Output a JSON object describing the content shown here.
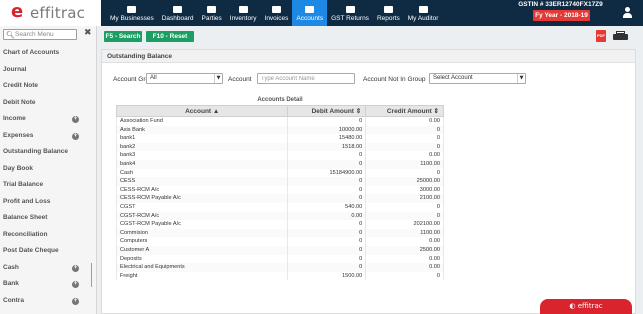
{
  "brand": {
    "name": "effitrac",
    "logo_mark": "e",
    "accent": "#d9232d",
    "topbar_color": "#0f2a43",
    "active_tab_color": "#1e88e5"
  },
  "nav": [
    {
      "label": "My Businesses",
      "icon": "briefcase-icon"
    },
    {
      "label": "Dashboard",
      "icon": "monitor-icon"
    },
    {
      "label": "Parties",
      "icon": "users-icon"
    },
    {
      "label": "Inventory",
      "icon": "box-icon"
    },
    {
      "label": "Invoices",
      "icon": "document-icon"
    },
    {
      "label": "Accounts",
      "icon": "briefcase-icon",
      "active": true
    },
    {
      "label": "GST Returns",
      "icon": "tax-icon"
    },
    {
      "label": "Reports",
      "icon": "folder-icon"
    },
    {
      "label": "My Auditor",
      "icon": "folder-user-icon"
    }
  ],
  "header": {
    "gstin": "GSTIN # 33ER12740FX17Z9",
    "fy": "Fy Year - 2018-19",
    "user_icon": "user-icon"
  },
  "sidebar": {
    "search_placeholder": "Search Menu",
    "items": [
      {
        "label": "Chart of Accounts",
        "expandable": false
      },
      {
        "label": "Journal",
        "expandable": false
      },
      {
        "label": "Credit Note",
        "expandable": false
      },
      {
        "label": "Debit Note",
        "expandable": false
      },
      {
        "label": "Income",
        "expandable": true
      },
      {
        "label": "Expenses",
        "expandable": true
      },
      {
        "label": "Outstanding Balance",
        "expandable": false
      },
      {
        "label": "Day Book",
        "expandable": false
      },
      {
        "label": "Trial Balance",
        "expandable": false
      },
      {
        "label": "Profit and Loss",
        "expandable": false
      },
      {
        "label": "Balance Sheet",
        "expandable": false
      },
      {
        "label": "Reconciliation",
        "expandable": false
      },
      {
        "label": "Post Date Cheque",
        "expandable": false
      },
      {
        "label": "Cash",
        "expandable": true
      },
      {
        "label": "Bank",
        "expandable": true
      },
      {
        "label": "Contra",
        "expandable": true
      }
    ]
  },
  "toolbar": {
    "search_label": "F5 - Search",
    "reset_label": "F10 - Reset",
    "button_color": "#1b9e63"
  },
  "panel": {
    "title": "Outstanding Balance",
    "account_group_label": "Account Group",
    "account_group_value": "All",
    "account_label": "Account",
    "account_placeholder": "Type Account Name",
    "not_in_group_label": "Account Not In Group",
    "not_in_group_value": "Select Account"
  },
  "table": {
    "caption": "Accounts Detail",
    "columns": [
      "Account ▲",
      "Debit Amount ⇕",
      "Credit Amount ⇕"
    ],
    "rows": [
      [
        "Association Fund",
        "0",
        "0.00"
      ],
      [
        "Axis Bank",
        "10000.00",
        "0"
      ],
      [
        "bank1",
        "15480.00",
        "0"
      ],
      [
        "bank2",
        "1518.00",
        "0"
      ],
      [
        "bank3",
        "0",
        "0.00"
      ],
      [
        "bank4",
        "0",
        "1100.00"
      ],
      [
        "Cash",
        "15184900.00",
        "0"
      ],
      [
        "CESS",
        "0",
        "25000.00"
      ],
      [
        "CESS-RCM A/c",
        "0",
        "3000.00"
      ],
      [
        "CESS-RCM Payable A/c",
        "0",
        "2100.00"
      ],
      [
        "CGST",
        "540.00",
        "0"
      ],
      [
        "CGST-RCM A/c",
        "0.00",
        "0"
      ],
      [
        "CGST-RCM Payable A/c",
        "0",
        "202100.00"
      ],
      [
        "Commision",
        "0",
        "1100.00"
      ],
      [
        "Computers",
        "0",
        "0.00"
      ],
      [
        "Customer A",
        "0",
        "2500.00"
      ],
      [
        "Deposits",
        "0",
        "0.00"
      ],
      [
        "Electrical and Equipments",
        "0",
        "0.00"
      ],
      [
        "Freight",
        "1500.00",
        "0"
      ]
    ]
  },
  "footer": {
    "brand_tag": "effitrac"
  }
}
